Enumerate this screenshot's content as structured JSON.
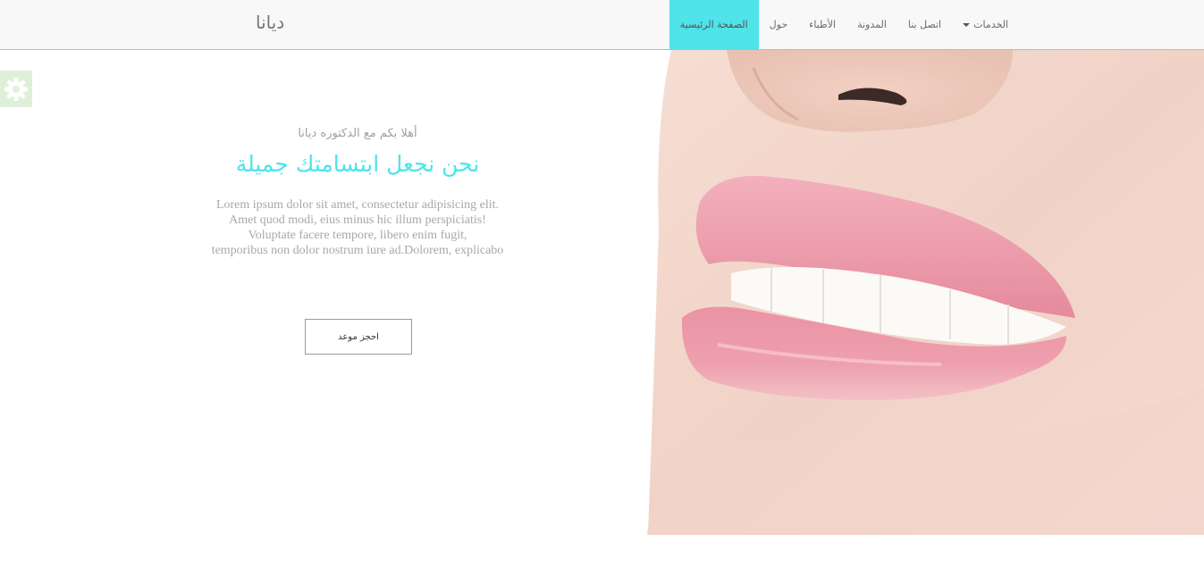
{
  "navbar": {
    "brand": "ديانا",
    "items": [
      {
        "label": "الصفحة الرئيسية",
        "active": true
      },
      {
        "label": "حول",
        "active": false
      },
      {
        "label": "الأطباء",
        "active": false
      },
      {
        "label": "المدونة",
        "active": false
      },
      {
        "label": "اتصل بنا",
        "active": false
      },
      {
        "label": "الخدمات",
        "active": false,
        "dropdown": true
      }
    ]
  },
  "settings": {
    "icon": "gear-icon"
  },
  "hero": {
    "greeting": "أهلا بكم مع الدكتوره ديانا",
    "headline": "نحن نجعل ابتسامتك جميلة",
    "description_lines": [
      "Lorem ipsum dolor sit amet, consectetur adipisicing elit.",
      "Amet quod modi, eius minus hic illum perspiciatis!",
      "Voluptate facere tempore, libero enim fugit,",
      "temporibus non dolor nostrum iure ad.Dolorem, explicabo"
    ],
    "button_label": "احجز موعد",
    "image": "smiling-lips-photo"
  },
  "colors": {
    "accent": "#4fe3ea",
    "navbar_bg": "#f8f8f8",
    "settings_bg": "#dff0d8"
  }
}
